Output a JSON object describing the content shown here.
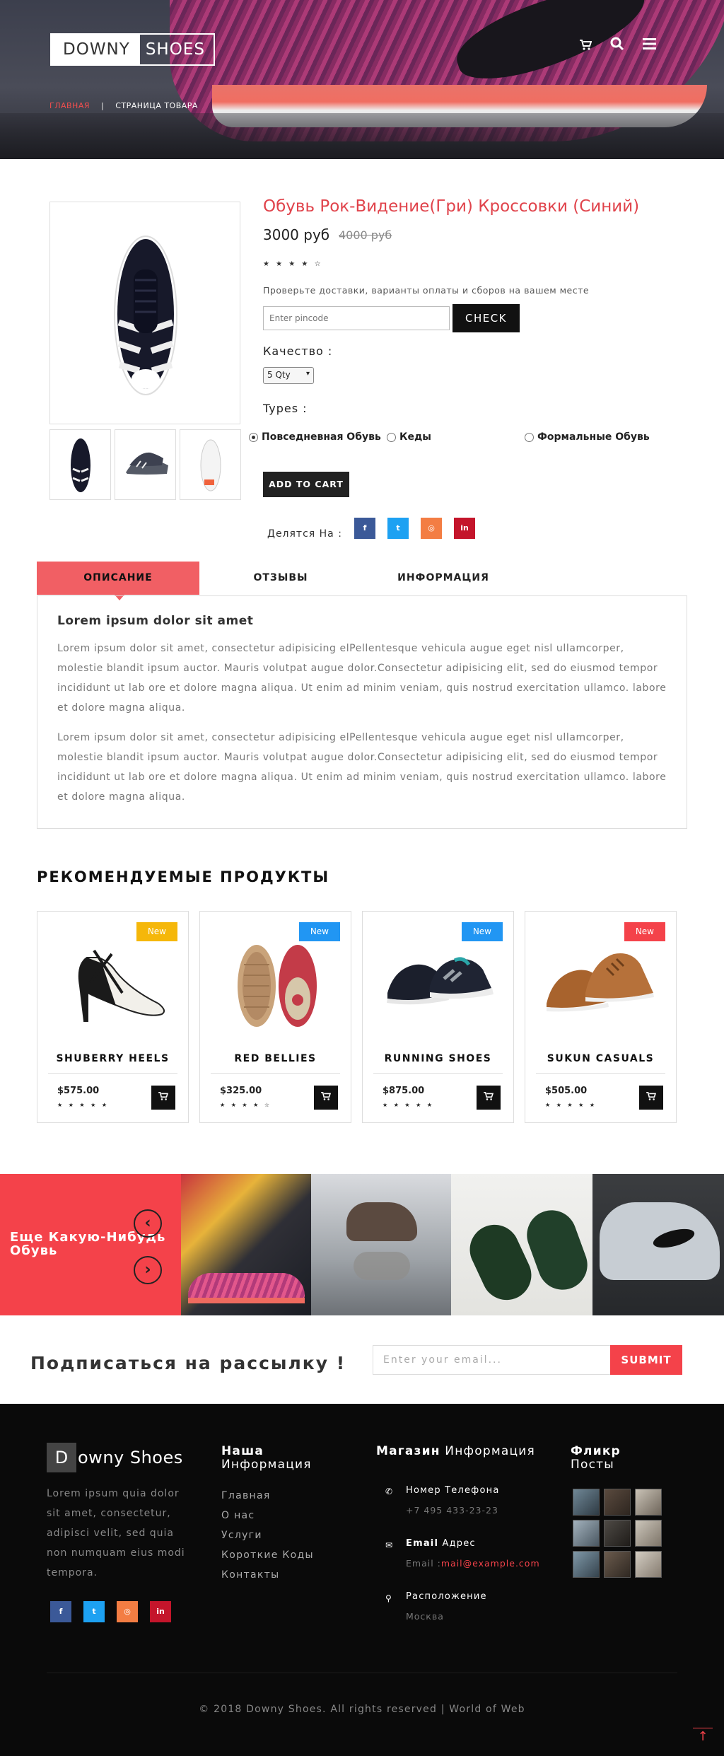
{
  "header": {
    "logo_part1": "DOWNY",
    "logo_part2": "SHOES",
    "cart_icon": "cart-icon",
    "search_icon": "search-icon",
    "menu_icon": "menu-icon",
    "breadcrumb": {
      "home": "ГЛАВНАЯ",
      "separator": "|",
      "current": "СТРАНИЦА ТОВАРА"
    }
  },
  "product": {
    "title": "Обувь Рок-Видение(Гри) Кроссовки (Синий)",
    "price": "3000 руб",
    "old_price": "4000 руб",
    "rating": 3.5,
    "stars": "★ ★ ★ ★ ☆",
    "check_text": "Проверьте доставки, варианты оплаты и сборов на вашем месте",
    "pincode_placeholder": "Enter pincode",
    "check_label": "CHECK",
    "quantity_label": "Качество :",
    "quantity_selected": "5 Qty",
    "types_label": "Types :",
    "types": [
      "Повседневная Обувь",
      "Кеды",
      "Формальные Обувь"
    ],
    "type_selected": "Повседневная Обувь",
    "add_to_cart": "ADD TO CART",
    "share_label": "Делятся На :",
    "share_icons": [
      "f",
      "t",
      "◎",
      "in"
    ]
  },
  "tabs": {
    "items": [
      "ОПИСАНИЕ",
      "ОТЗЫВЫ",
      "ИНФОРМАЦИЯ"
    ],
    "active": "ОПИСАНИЕ",
    "heading": "Lorem ipsum dolor sit amet",
    "paragraphs": [
      "Lorem ipsum dolor sit amet, consectetur adipisicing elPellentesque vehicula augue eget nisl ullamcorper, molestie blandit ipsum auctor. Mauris volutpat augue dolor.Consectetur adipisicing elit, sed do eiusmod tempor incididunt ut lab ore et dolore magna aliqua. Ut enim ad minim veniam, quis nostrud exercitation ullamco. labore et dolore magna aliqua.",
      "Lorem ipsum dolor sit amet, consectetur adipisicing elPellentesque vehicula augue eget nisl ullamcorper, molestie blandit ipsum auctor. Mauris volutpat augue dolor.Consectetur adipisicing elit, sed do eiusmod tempor incididunt ut lab ore et dolore magna aliqua. Ut enim ad minim veniam, quis nostrud exercitation ullamco. labore et dolore magna aliqua."
    ]
  },
  "recommended": {
    "title": "РЕКОМЕНДУЕМЫЕ ПРОДУКТЫ",
    "products": [
      {
        "name": "SHUBERRY HEELS",
        "price": "$575.00",
        "badge": "New",
        "badge_color": "#f5b70a",
        "stars": "★ ★ ★ ★ ★"
      },
      {
        "name": "RED BELLIES",
        "price": "$325.00",
        "badge": "New",
        "badge_color": "#2196f3",
        "stars": "★ ★ ★ ★ ☆"
      },
      {
        "name": "RUNNING SHOES",
        "price": "$875.00",
        "badge": "New",
        "badge_color": "#2196f3",
        "stars": "★ ★ ★ ★ ★"
      },
      {
        "name": "SUKUN CASUALS",
        "price": "$505.00",
        "badge": "New",
        "badge_color": "#f4424a",
        "stars": "★ ★ ★ ★ ★"
      }
    ]
  },
  "banner": {
    "text": "Еще Какую-Нибудь Обувь",
    "prev": "‹",
    "next": "›"
  },
  "newsletter": {
    "title": "Подписаться на рассылку !",
    "placeholder": "Enter your email...",
    "button": "SUBMIT"
  },
  "footer": {
    "logo_letter": "D",
    "logo_rest": "owny Shoes",
    "about": "Lorem ipsum quia dolor sit amet, consectetur, adipisci velit, sed quia non numquam eius modi tempora.",
    "info_heading_bold": "Наша",
    "info_heading_rest": "Информация",
    "links": [
      "Главная",
      "О нас",
      "Услуги",
      "Короткие Коды",
      "Контакты"
    ],
    "store_heading_bold": "Магазин",
    "store_heading_rest": "Информация",
    "phone_label": "Номер Телефона",
    "phone": "+7 495 433-23-23",
    "email_label_bold": "Email",
    "email_label_rest": "Адрес",
    "email_prefix": "Email :",
    "email": "mail@example.com",
    "location_label": "Расположение",
    "location": "Москва",
    "flickr_heading_bold": "Фликр",
    "flickr_heading_rest": "Посты",
    "copyright": "© 2018 Downy Shoes. All rights reserved | World of Web",
    "to_top": "↑"
  },
  "colors": {
    "accent": "#f4424a",
    "facebook": "#3b5998",
    "twitter": "#1da1f2",
    "instagram": "#f37d43",
    "linkedin": "#c4152b"
  }
}
